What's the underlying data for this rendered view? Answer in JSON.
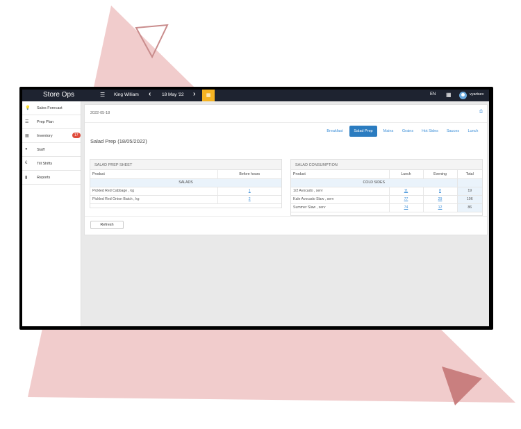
{
  "app": {
    "brand": "Store Ops",
    "store": "King William",
    "date": "18 May '22",
    "language": "EN",
    "user": "vyartsev"
  },
  "sidebar": {
    "items": [
      {
        "label": "Sales Forecast",
        "icon": "lightbulb-icon"
      },
      {
        "label": "Prep Plan",
        "icon": "list-icon"
      },
      {
        "label": "Inventory",
        "icon": "building-icon",
        "badge": "17"
      },
      {
        "label": "Staff",
        "icon": "person-icon"
      },
      {
        "label": "Till Shifts",
        "icon": "euro-icon"
      },
      {
        "label": "Reports",
        "icon": "bar-chart-icon"
      }
    ]
  },
  "panel": {
    "date": "2022-05-18",
    "title": "Salad Prep (18/05/2022)",
    "tabs": [
      "Breakfast",
      "Salad Prep",
      "Mains",
      "Grains",
      "Hot Sides",
      "Sauces",
      "Lunch"
    ],
    "active_tab": "Salad Prep",
    "refresh_label": "Refresh"
  },
  "prep_sheet": {
    "title": "SALAD PREP SHEET",
    "headers": [
      "Product",
      "Before hours"
    ],
    "group": "SALADS",
    "rows": [
      {
        "product": "Pickled Red Cabbage , kg",
        "before": "1"
      },
      {
        "product": "Pickled Red Onion Batch , kg",
        "before": "2"
      }
    ]
  },
  "consumption": {
    "title": "SALAD CONSUMPTION",
    "headers": [
      "Product",
      "Lunch",
      "Evening",
      "Total"
    ],
    "group": "COLD SIDES",
    "rows": [
      {
        "product": "1/2 Avocado , serv",
        "lunch": "11",
        "evening": "8",
        "total": "19"
      },
      {
        "product": "Kale Avocado Slaw , serv",
        "lunch": "77",
        "evening": "29",
        "total": "106"
      },
      {
        "product": "Summer Slaw , serv",
        "lunch": "74",
        "evening": "12",
        "total": "86"
      }
    ]
  },
  "colors": {
    "topbar": "#1e2330",
    "accent": "#2b7cc0",
    "calendar": "#f5b323",
    "badge": "#e04b3b",
    "decor_triangle": "#f1cccc"
  }
}
